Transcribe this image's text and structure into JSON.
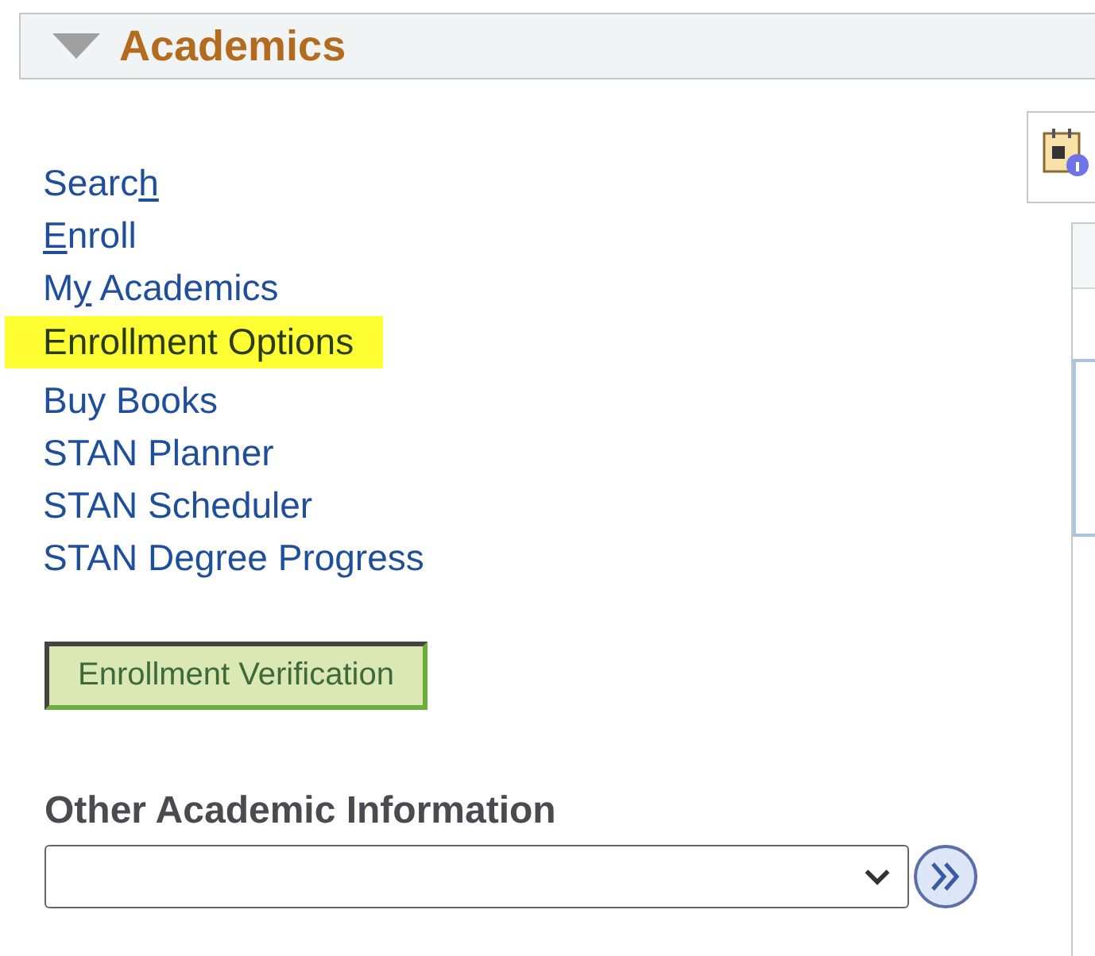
{
  "section": {
    "title": "Academics",
    "expanded": true
  },
  "links": [
    {
      "prefix": "Searc",
      "key": "h",
      "highlighted": false
    },
    {
      "key": "E",
      "suffix": "nroll",
      "highlighted": false
    },
    {
      "prefix": "M",
      "key": "y",
      "suffix": " Academics",
      "highlighted": false
    },
    {
      "prefix": "Enrollment Options",
      "highlighted": true
    },
    {
      "prefix": "Buy Books",
      "highlighted": false
    },
    {
      "prefix": "STAN Planner",
      "highlighted": false
    },
    {
      "prefix": "STAN Scheduler",
      "highlighted": false
    },
    {
      "prefix": "STAN Degree Progress",
      "highlighted": false
    }
  ],
  "verify_button": "Enrollment Verification",
  "other_info": {
    "label": "Other Academic Information"
  }
}
